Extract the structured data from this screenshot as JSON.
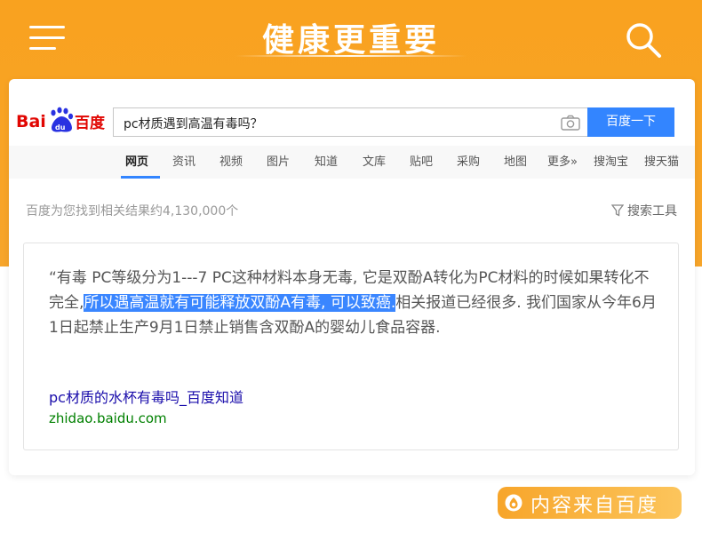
{
  "header": {
    "title": "健康更重要"
  },
  "baidu": {
    "logo_text": "Bai百度",
    "search": {
      "value": "pc材质遇到高温有毒吗？",
      "button_label": "百度一下"
    },
    "nav": [
      {
        "label": "网页",
        "active": true
      },
      {
        "label": "资讯"
      },
      {
        "label": "视频"
      },
      {
        "label": "图片"
      },
      {
        "label": "知道"
      },
      {
        "label": "文库"
      },
      {
        "label": "贴吧"
      },
      {
        "label": "采购"
      },
      {
        "label": "地图"
      },
      {
        "label": "更多»"
      },
      {
        "label": "搜淘宝"
      },
      {
        "label": "搜天猫"
      }
    ],
    "result_count": "百度为您找到相关结果约4,130,000个",
    "tools_label": "搜索工具",
    "result": {
      "text_before": "“有毒 PC等级分为1---7 PC这种材料本身无毒, 它是双酚A转化为PC材料的时候如果转化不完全,",
      "text_highlight": "所以遇高温就有可能释放双酚A有毒, 可以致癌.",
      "text_after": "相关报道已经很多. 我们国家从今年6月1日起禁止生产9月1日禁止销售含双酚A的婴幼儿食品容器.",
      "link_title": "pc材质的水杯有毒吗_百度知道",
      "link_url": "zhidao.baidu.com"
    }
  },
  "source_badge": "内容来自百度",
  "colors": {
    "header_orange": "#f9a21f",
    "baidu_blue": "#3385ff",
    "baidu_red": "#e10602",
    "highlight_blue": "#3a86ff",
    "link_blue": "#1a0dab",
    "url_green": "#008000"
  }
}
